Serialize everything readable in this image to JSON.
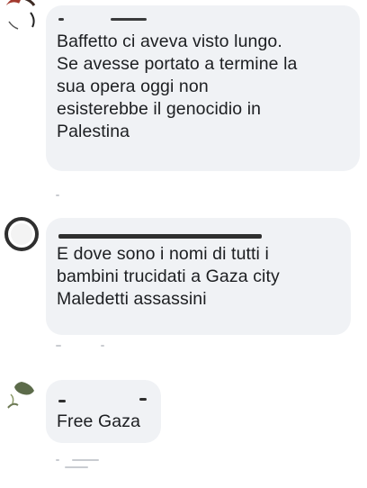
{
  "comments": [
    {
      "text": "Baffetto ci aveva visto lungo.\nSe avesse portato a termine la\nsua opera oggi non\nesisterebbe il genocidio in\nPalestina"
    },
    {
      "text": "E dove sono i nomi di tutti i\nbambini trucidati a Gaza city\nMaledetti assassini"
    },
    {
      "text": "Free Gaza"
    }
  ],
  "colors": {
    "bubble": "#f0f2f5",
    "text": "#1c1e21"
  }
}
